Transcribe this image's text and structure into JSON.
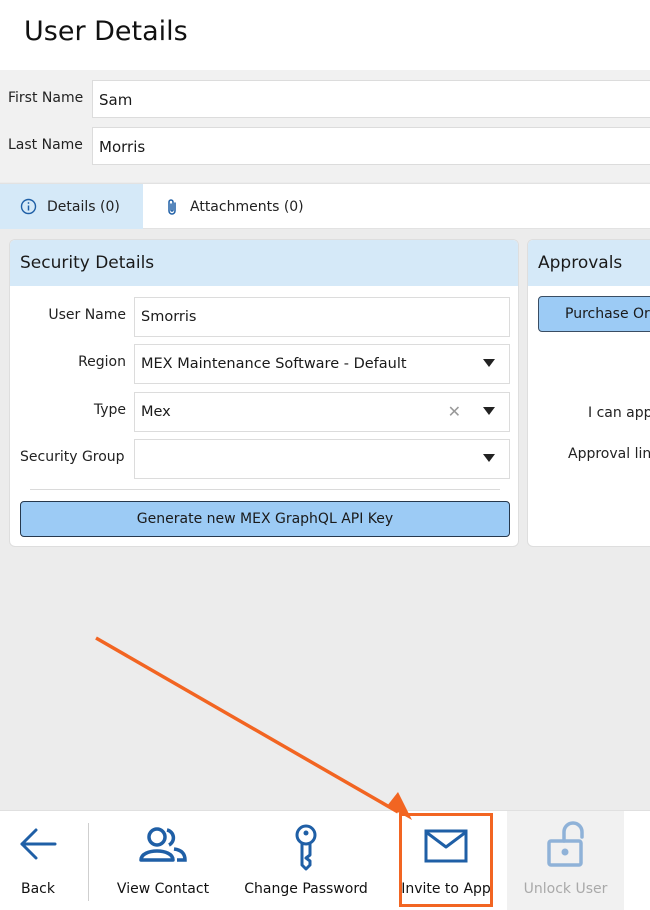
{
  "page": {
    "title": "User Details"
  },
  "user": {
    "first_name_label": "First Name",
    "first_name_value": "Sam",
    "last_name_label": "Last Name",
    "last_name_value": "Morris"
  },
  "tabs": [
    {
      "label": "Details (0)",
      "icon": "info-icon",
      "active": true
    },
    {
      "label": "Attachments (0)",
      "icon": "paperclip-icon",
      "active": false
    }
  ],
  "security": {
    "title": "Security Details",
    "fields": [
      {
        "label": "User Name",
        "value": "Smorris",
        "type": "text"
      },
      {
        "label": "Region",
        "value": "MEX Maintenance Software - Default",
        "type": "select"
      },
      {
        "label": "Type",
        "value": "Mex",
        "type": "select-clearable"
      },
      {
        "label": "Security Group",
        "value": "",
        "type": "select"
      }
    ],
    "generate_button": "Generate new MEX GraphQL API Key"
  },
  "approvals": {
    "title": "Approvals",
    "purchase_button": "Purchase Or",
    "can_approve_label": "I can app",
    "approval_limit_label": "Approval lin"
  },
  "toolbar": {
    "back": "Back",
    "view_contact": "View Contact",
    "change_password": "Change Password",
    "invite_to_app": "Invite to App",
    "unlock_user": "Unlock User"
  },
  "colors": {
    "accent_light": "#d5e9f8",
    "button_blue": "#9ccbf5",
    "icon_blue": "#1f5fa6",
    "annotation": "#f26522",
    "disabled": "#a9a9a9"
  }
}
